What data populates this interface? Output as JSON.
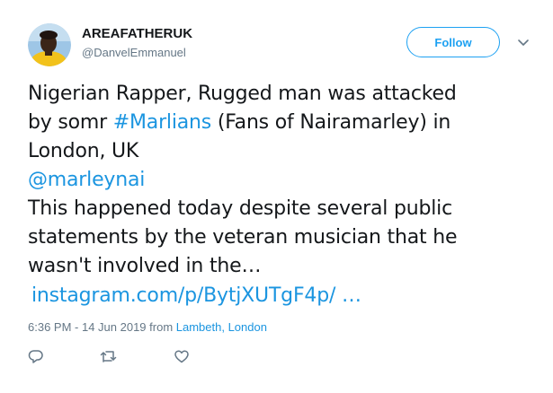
{
  "tweet": {
    "display_name": "AREAFATHERUK",
    "handle": "@DanvelEmmanuel",
    "follow_label": "Follow",
    "text": {
      "line1": "Nigerian Rapper, Rugged man was attacked",
      "line2_before": "by somr ",
      "line2_hashtag": "#Marlians",
      "line2_after": " (Fans of Nairamarley) in",
      "line3": "London, UK",
      "mention": "@marleynai",
      "line5": "This happened today despite several public",
      "line6": "statements by the veteran musician that he",
      "line7": "wasn't involved in the…",
      "url": "instagram.com/p/BytjXUTgF4p/ …"
    },
    "meta": {
      "timestamp": "6:36 PM - 14 Jun 2019 from ",
      "location": "Lambeth, London"
    }
  },
  "icons": {
    "avatar": "avatar",
    "caret": "chevron-down-icon",
    "reply": "reply-icon",
    "retweet": "retweet-icon",
    "like": "heart-icon"
  },
  "colors": {
    "link": "#1b95e0",
    "follow_border": "#1da1f2",
    "secondary_text": "#657786",
    "primary_text": "#14171a"
  }
}
